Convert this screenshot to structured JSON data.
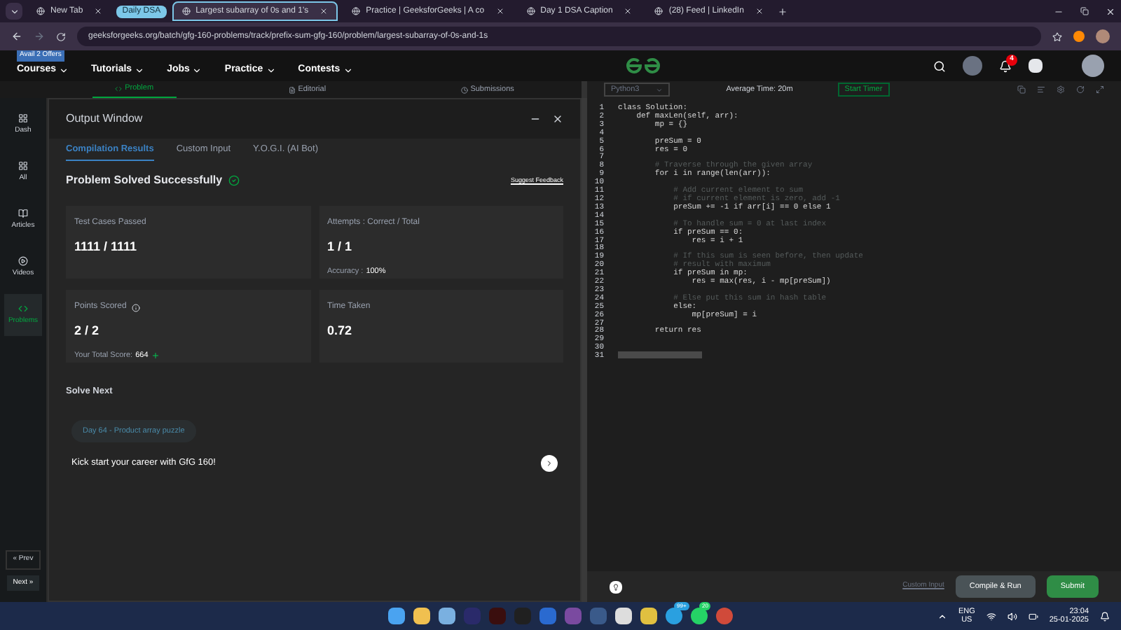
{
  "browser": {
    "tabs": [
      {
        "label": "New Tab",
        "selected": false
      },
      {
        "label": "Largest subarray of 0s and 1's",
        "selected": true
      },
      {
        "label": "Practice | GeeksforGeeks | A co",
        "selected": false
      },
      {
        "label": "Day 1 DSA Caption",
        "selected": false
      },
      {
        "label": "(28) Feed | LinkedIn",
        "selected": false
      }
    ],
    "tab_group": "Daily DSA",
    "url": "geeksforgeeks.org/batch/gfg-160-problems/track/prefix-sum-gfg-160/problem/largest-subarray-of-0s-and-1s"
  },
  "site_nav": {
    "offer_badge": "Avail 2 Offers",
    "items": [
      "Courses",
      "Tutorials",
      "Jobs",
      "Practice",
      "Contests"
    ],
    "notifications": "4"
  },
  "problem_tabs": [
    {
      "label": "Problem",
      "selected": true
    },
    {
      "label": "Editorial",
      "selected": false
    },
    {
      "label": "Submissions",
      "selected": false
    }
  ],
  "sidebar": {
    "items": [
      {
        "label": "Dash",
        "selected": false
      },
      {
        "label": "All",
        "selected": false
      },
      {
        "label": "Articles",
        "selected": false
      },
      {
        "label": "Videos",
        "selected": false
      },
      {
        "label": "Problems",
        "selected": true
      }
    ],
    "prev": "« Prev",
    "next": "Next »"
  },
  "output_window": {
    "title": "Output Window",
    "tabs": [
      {
        "label": "Compilation Results",
        "selected": true
      },
      {
        "label": "Custom Input",
        "selected": false
      },
      {
        "label": "Y.O.G.I. (AI Bot)",
        "selected": false
      }
    ],
    "status": "Problem Solved Successfully",
    "feedback": "Suggest Feedback",
    "cards": [
      {
        "label": "Test Cases Passed",
        "value": "1111 / 1111"
      },
      {
        "label": "Attempts : Correct / Total",
        "value": "1 / 1",
        "note_label": "Accuracy :",
        "note_value": "100%"
      },
      {
        "label": "Points Scored",
        "value": "2 / 2",
        "note_label": "Your Total Score:",
        "note_value": "664",
        "info": true
      },
      {
        "label": "Time Taken",
        "value": "0.72"
      }
    ],
    "solve_next": "Solve Next",
    "next_chip": "Day 64 - Product array puzzle",
    "promo": "Kick start your career with GfG 160!"
  },
  "editor": {
    "language": "Python3",
    "average_time": "Average Time: 20m",
    "timer": "Start Timer",
    "lines": [
      {
        "number": "1",
        "text": "class Solution:",
        "kind": "code"
      },
      {
        "number": "2",
        "text": "    def maxLen(self, arr):",
        "kind": "code"
      },
      {
        "number": "3",
        "text": "        mp = {}",
        "kind": "code"
      },
      {
        "number": "4",
        "kind": "code"
      },
      {
        "number": "5",
        "text": "        preSum = 0",
        "kind": "code"
      },
      {
        "number": "6",
        "text": "        res = 0",
        "kind": "code"
      },
      {
        "number": "7",
        "kind": "code"
      },
      {
        "number": "8",
        "text": "        # Traverse through the given array",
        "kind": "comment"
      },
      {
        "number": "9",
        "text": "        for i in range(len(arr)):",
        "kind": "code"
      },
      {
        "number": "10",
        "kind": "code"
      },
      {
        "number": "11",
        "text": "            # Add current element to sum",
        "kind": "comment"
      },
      {
        "number": "12",
        "text": "            # if current element is zero, add -1",
        "kind": "comment"
      },
      {
        "number": "13",
        "text": "            preSum += -1 if arr[i] == 0 else 1",
        "kind": "code"
      },
      {
        "number": "14",
        "kind": "code"
      },
      {
        "number": "15",
        "text": "            # To handle sum = 0 at last index",
        "kind": "comment"
      },
      {
        "number": "16",
        "text": "            if preSum == 0:",
        "kind": "code"
      },
      {
        "number": "17",
        "text": "                res = i + 1",
        "kind": "code"
      },
      {
        "number": "18",
        "kind": "code"
      },
      {
        "number": "19",
        "text": "            # If this sum is seen before, then update",
        "kind": "comment"
      },
      {
        "number": "20",
        "text": "            # result with maximum",
        "kind": "comment"
      },
      {
        "number": "21",
        "text": "            if preSum in mp:",
        "kind": "code"
      },
      {
        "number": "22",
        "text": "                res = max(res, i - mp[preSum])",
        "kind": "code"
      },
      {
        "number": "23",
        "kind": "code"
      },
      {
        "number": "24",
        "text": "            # Else put this sum in hash table",
        "kind": "comment"
      },
      {
        "number": "25",
        "text": "            else:",
        "kind": "code"
      },
      {
        "number": "26",
        "text": "                mp[preSum] = i",
        "kind": "code"
      },
      {
        "number": "27",
        "kind": "code"
      },
      {
        "number": "28",
        "text": "        return res",
        "kind": "code"
      },
      {
        "number": "29",
        "kind": "code"
      },
      {
        "number": "30",
        "kind": "code"
      },
      {
        "number": "31",
        "kind": "highlight"
      }
    ],
    "custom_input": "Custom Input",
    "compile": "Compile & Run",
    "submit": "Submit"
  },
  "taskbar": {
    "telegram_badge": "99+",
    "whatsapp_badge": "20",
    "lang": "ENG",
    "region": "US",
    "time": "23:04",
    "date": "25-01-2025"
  }
}
